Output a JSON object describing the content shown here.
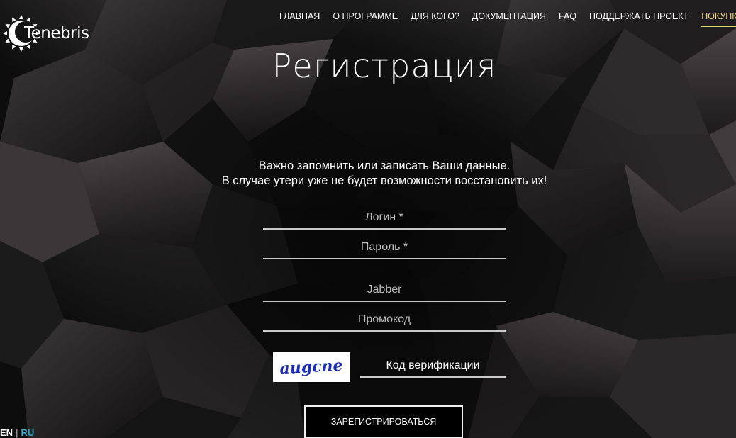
{
  "brand": {
    "name": "Tenebris"
  },
  "nav": {
    "items": [
      {
        "label": "ГЛАВНАЯ"
      },
      {
        "label": "О ПРОГРАММЕ"
      },
      {
        "label": "ДЛЯ КОГО?"
      },
      {
        "label": "ДОКУМЕНТАЦИЯ"
      },
      {
        "label": "FAQ"
      },
      {
        "label": "ПОДДЕРЖАТЬ ПРОЕКТ"
      },
      {
        "label": "ПОКУПКА И ВХ"
      }
    ],
    "active_color": "#ead27a"
  },
  "page": {
    "title": "Регистрация",
    "notice_line1": "Важно запомнить или записать Ваши данные.",
    "notice_line2": "В случае утери уже не будет возможности восстановить их!"
  },
  "form": {
    "login_placeholder": "Логин *",
    "password_placeholder": "Пароль *",
    "jabber_placeholder": "Jabber",
    "promo_placeholder": "Промокод",
    "captcha_text": "augcne",
    "captcha_color": "#1e2fb8",
    "verification_placeholder": "Код верификации",
    "submit_label": "ЗАРЕГИСТРИРОВАТЬСЯ"
  },
  "language": {
    "en": "EN",
    "separator": "|",
    "ru": "RU",
    "ru_color": "#3ea3c8"
  }
}
